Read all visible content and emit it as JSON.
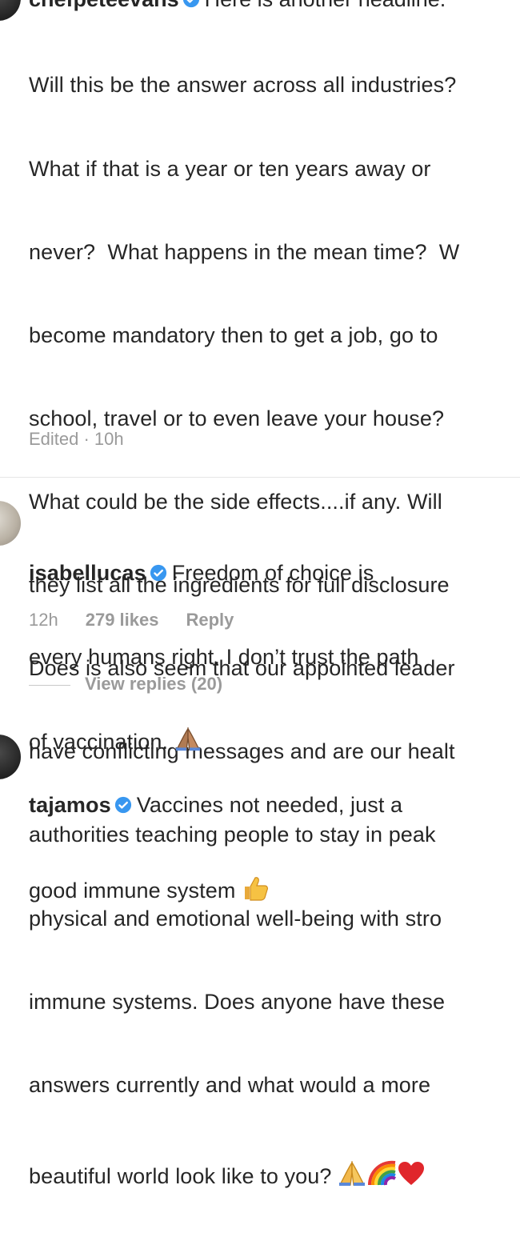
{
  "comment1": {
    "username": "chefpeteevans",
    "first_line_text": "Here is another headline.",
    "lines": [
      "Will this be the answer across all industries?",
      "What if that is a year or ten years away or",
      "never?  What happens in the mean time?  W",
      "become mandatory then to get a job, go to",
      "school, travel or to even leave your house?",
      "What could be the side effects....if any. Will",
      "they list all the ingredients for full disclosure",
      "Does is also seem that our appointed leader",
      "have conflicting messages and are our healt",
      "authorities teaching people to stay in peak",
      "physical and emotional well-being with stro",
      "immune systems. Does anyone have these",
      "answers currently and what would a more",
      "beautiful world look like to you?"
    ],
    "meta": "Edited · 10h"
  },
  "comment2": {
    "username": "isabellucas",
    "line1": "Freedom of choice is",
    "line2": "every humans right. I don’t trust the path",
    "line3": "of vaccination.",
    "time": "12h",
    "likes": "279 likes",
    "reply": "Reply",
    "view_replies": "View replies (20)"
  },
  "comment3": {
    "username": "tajamos",
    "line1": "Vaccines not needed, just a",
    "line2": "good immune system"
  },
  "colors": {
    "text": "#262626",
    "meta": "#9a9a9a",
    "verified": "#3897f0",
    "background": "#ffffff"
  },
  "icons": [
    "verified-badge-icon",
    "praying-hands-emoji",
    "rainbow-emoji",
    "red-heart-emoji",
    "thumbs-up-emoji"
  ]
}
